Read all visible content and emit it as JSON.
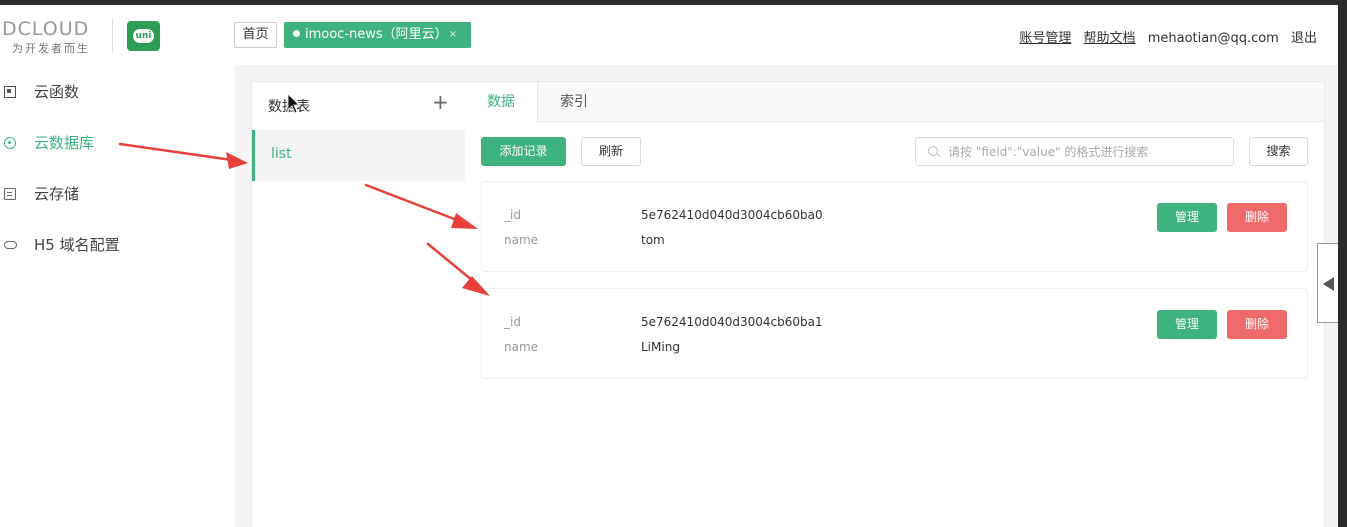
{
  "header": {
    "logo_text": "DCLOUD",
    "logo_subtitle": "为开发者而生",
    "uni_logo_text": "uni",
    "tabs": [
      {
        "label": "首页",
        "active": false
      },
      {
        "label": "imooc-news（阿里云）",
        "active": true,
        "close": "×"
      }
    ],
    "nav": [
      {
        "label": "账号管理",
        "link": true
      },
      {
        "label": "帮助文档",
        "link": true
      },
      {
        "label": "mehaotian@qq.com",
        "link": false
      },
      {
        "label": "退出",
        "link": false
      }
    ]
  },
  "sidebar": {
    "items": [
      {
        "label": "云函数",
        "icon": "function-icon",
        "active": false
      },
      {
        "label": "云数据库",
        "icon": "database-icon",
        "active": true
      },
      {
        "label": "云存储",
        "icon": "storage-icon",
        "active": false
      },
      {
        "label": "H5 域名配置",
        "icon": "link-icon",
        "active": false
      }
    ]
  },
  "tables_panel": {
    "title": "数据表",
    "add_symbol": "+",
    "items": [
      {
        "label": "list",
        "selected": true
      }
    ]
  },
  "main": {
    "tabs": [
      {
        "label": "数据",
        "active": true
      },
      {
        "label": "索引",
        "active": false
      }
    ],
    "toolbar": {
      "add_label": "添加记录",
      "refresh_label": "刷新",
      "search_placeholder": "请按 \"field\":\"value\" 的格式进行搜索",
      "search_label": "搜索"
    },
    "records": [
      {
        "fields": [
          {
            "key": "_id",
            "value": "5e762410d040d3004cb60ba0"
          },
          {
            "key": "name",
            "value": "tom"
          }
        ],
        "manage_label": "管理",
        "delete_label": "删除"
      },
      {
        "fields": [
          {
            "key": "_id",
            "value": "5e762410d040d3004cb60ba1"
          },
          {
            "key": "name",
            "value": "LiMing"
          }
        ],
        "manage_label": "管理",
        "delete_label": "删除"
      }
    ]
  },
  "colors": {
    "accent": "#3fb37f",
    "danger": "#ef6b6b",
    "annotation_arrow": "#e8403a"
  }
}
